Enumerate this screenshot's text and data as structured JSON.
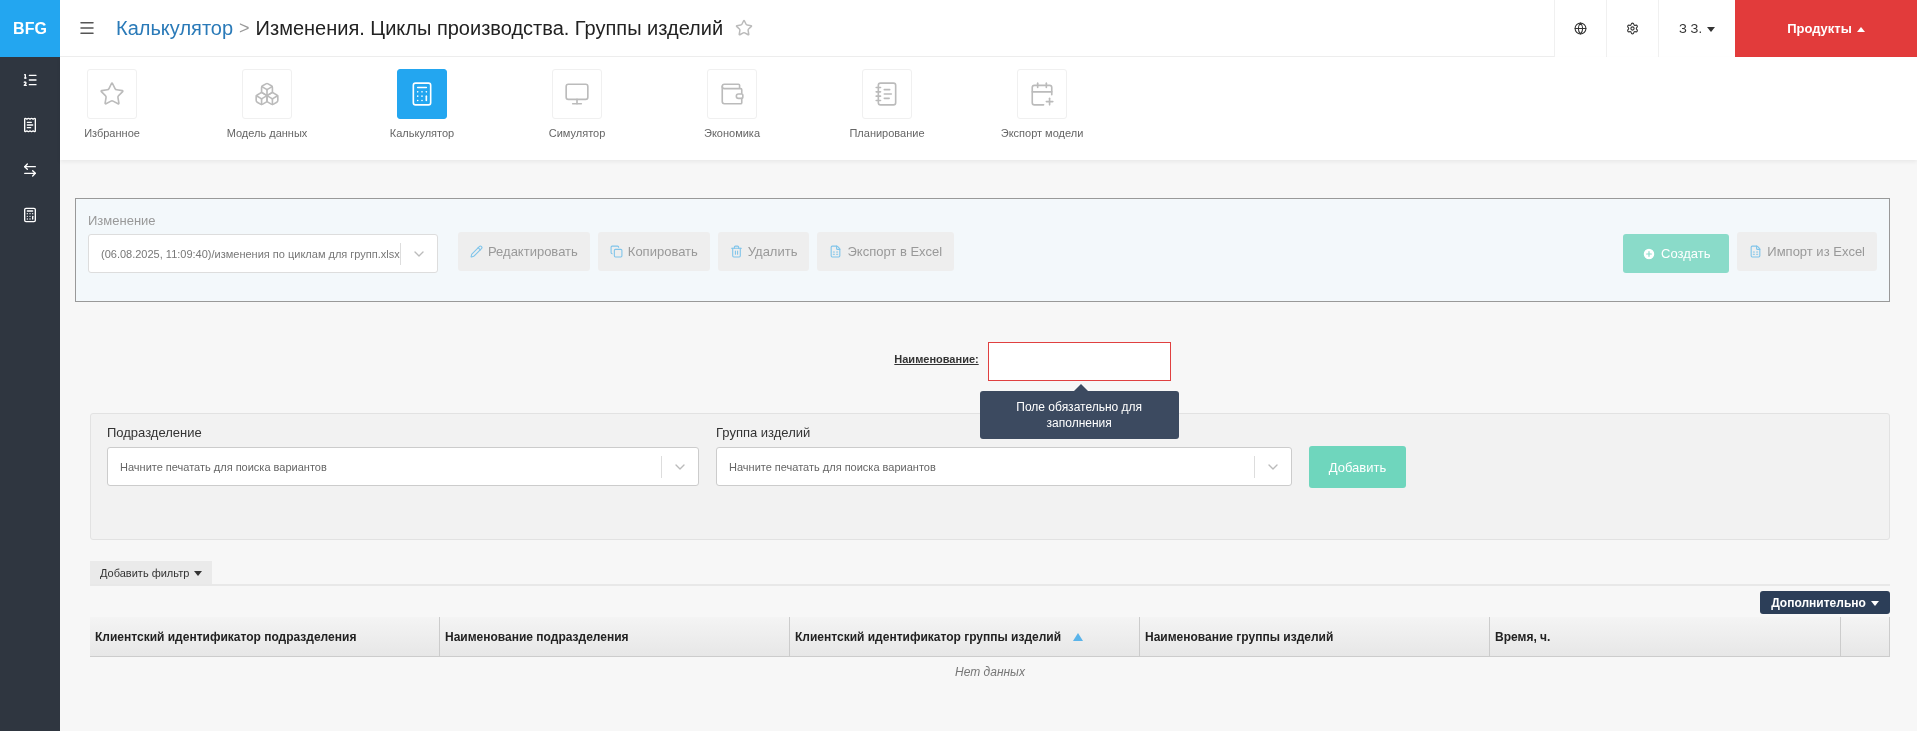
{
  "logo": "BFG",
  "sidebar": {
    "items": [
      {
        "kind": "list"
      },
      {
        "kind": "document"
      },
      {
        "kind": "exchange"
      },
      {
        "kind": "calculator"
      }
    ]
  },
  "header": {
    "breadcrumb": "Калькулятор",
    "separator": ">",
    "title": "Изменения. Циклы производства. Группы изделий",
    "favorite": false,
    "user": "З З.",
    "products": "Продукты"
  },
  "modules": [
    {
      "label": "Избранное",
      "kind": "star",
      "selected": false
    },
    {
      "label": "Модель данных",
      "kind": "boxes",
      "selected": false
    },
    {
      "label": "Калькулятор",
      "kind": "calculator",
      "selected": true
    },
    {
      "label": "Симулятор",
      "kind": "monitor",
      "selected": false
    },
    {
      "label": "Экономика",
      "kind": "wallet",
      "selected": false
    },
    {
      "label": "Планирование",
      "kind": "notebook",
      "selected": false
    },
    {
      "label": "Экспорт модели",
      "kind": "calendar",
      "selected": false
    }
  ],
  "change_panel": {
    "label": "Изменение",
    "value": "(06.08.2025, 11:09:40)/изменения по циклам для групп.xlsx",
    "actions": [
      {
        "label": "Редактировать",
        "kind": "edit"
      },
      {
        "label": "Копировать",
        "kind": "copy"
      },
      {
        "label": "Удалить",
        "kind": "delete"
      },
      {
        "label": "Экспорт в Excel",
        "kind": "excel"
      }
    ],
    "create": "Создать",
    "import": "Импорт из Excel"
  },
  "name_field": {
    "label": "Наименование:",
    "invalid": true,
    "tooltip": "Поле обязательно для заполнения"
  },
  "filter_panel": {
    "fields": [
      {
        "label": "Подразделение",
        "placeholder": "Начните печатать для поиска вариантов"
      },
      {
        "label": "Группа изделий",
        "placeholder": "Начните печатать для поиска вариантов"
      }
    ],
    "add": "Добавить"
  },
  "table": {
    "add_filter": "Добавить фильтр",
    "more": "Дополнительно",
    "columns": [
      {
        "label": "Клиентский идентификатор подразделения",
        "sorted": false
      },
      {
        "label": "Наименование подразделения",
        "sorted": false
      },
      {
        "label": "Клиентский идентификатор группы изделий",
        "sorted": true
      },
      {
        "label": "Наименование группы изделий",
        "sorted": false
      },
      {
        "label": "Время, ч.",
        "sorted": false
      }
    ],
    "empty": "Нет данных"
  }
}
